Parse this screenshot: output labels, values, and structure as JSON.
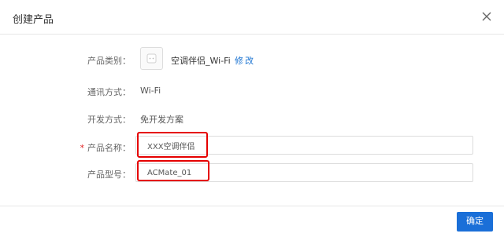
{
  "dialog": {
    "title": "创建产品",
    "close_icon": "close-icon"
  },
  "form": {
    "product_category_label": "产品类别：",
    "product_category_value": "空调伴侣_Wi-Fi",
    "product_category_icon": "smart-plug-icon",
    "modify_label": "修改",
    "comm_label": "通讯方式：",
    "comm_value": "Wi-Fi",
    "dev_label": "开发方式：",
    "dev_value": "免开发方案",
    "required_mark": "*",
    "name_label": "产品名称：",
    "name_value": "XXX空调伴侣",
    "model_label": "产品型号：",
    "model_value": "ACMate_01"
  },
  "footer": {
    "confirm_label": "确定"
  },
  "colors": {
    "accent": "#1a6fd8",
    "link": "#1a73d1",
    "highlight": "#e50000",
    "required": "#e02020"
  }
}
